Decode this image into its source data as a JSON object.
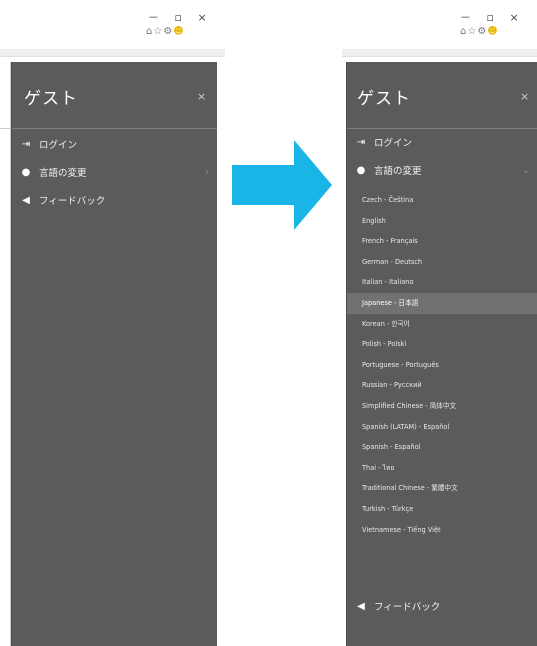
{
  "window_controls": "－  ▫  ×",
  "toolbar_icons": [
    "home-icon",
    "star-icon",
    "settings-icon",
    "smiley-icon"
  ],
  "colors": {
    "panel_bg": "#5b5b5b",
    "divider": "#7d7d7d",
    "selected_bg": "#717171",
    "arrow": "#19b5e6"
  },
  "before": {
    "panel": {
      "title": "ゲスト",
      "close": "×",
      "items": [
        {
          "icon": "sign-in-icon",
          "label": "ログイン"
        },
        {
          "icon": "globe-icon",
          "label": "言語の変更",
          "chevron": "›"
        },
        {
          "icon": "megaphone-icon",
          "label": "フィードバック"
        }
      ]
    }
  },
  "after": {
    "panel": {
      "title": "ゲスト",
      "close": "×",
      "login": {
        "icon": "sign-in-icon",
        "label": "ログイン"
      },
      "language": {
        "icon": "globe-icon",
        "label": "言語の変更",
        "chevron": "⌄",
        "expanded": true
      },
      "languages": [
        "Czech - Čeština",
        "English",
        "French - Français",
        "German - Deutsch",
        "Italian - Italiano",
        "Japanese - 日本語",
        "Korean - 한국어",
        "Polish - Polski",
        "Portuguese - Português",
        "Russian - Русский",
        "Simplified Chinese - 简体中文",
        "Spanish (LATAM) - Español",
        "Spanish - Español",
        "Thai - ไทย",
        "Traditional Chinese - 繁體中文",
        "Turkish - Türkçe",
        "Vietnamese - Tiếng Việt"
      ],
      "selected_language": "Japanese - 日本語",
      "feedback": {
        "icon": "megaphone-icon",
        "label": "フィードバック"
      }
    }
  }
}
